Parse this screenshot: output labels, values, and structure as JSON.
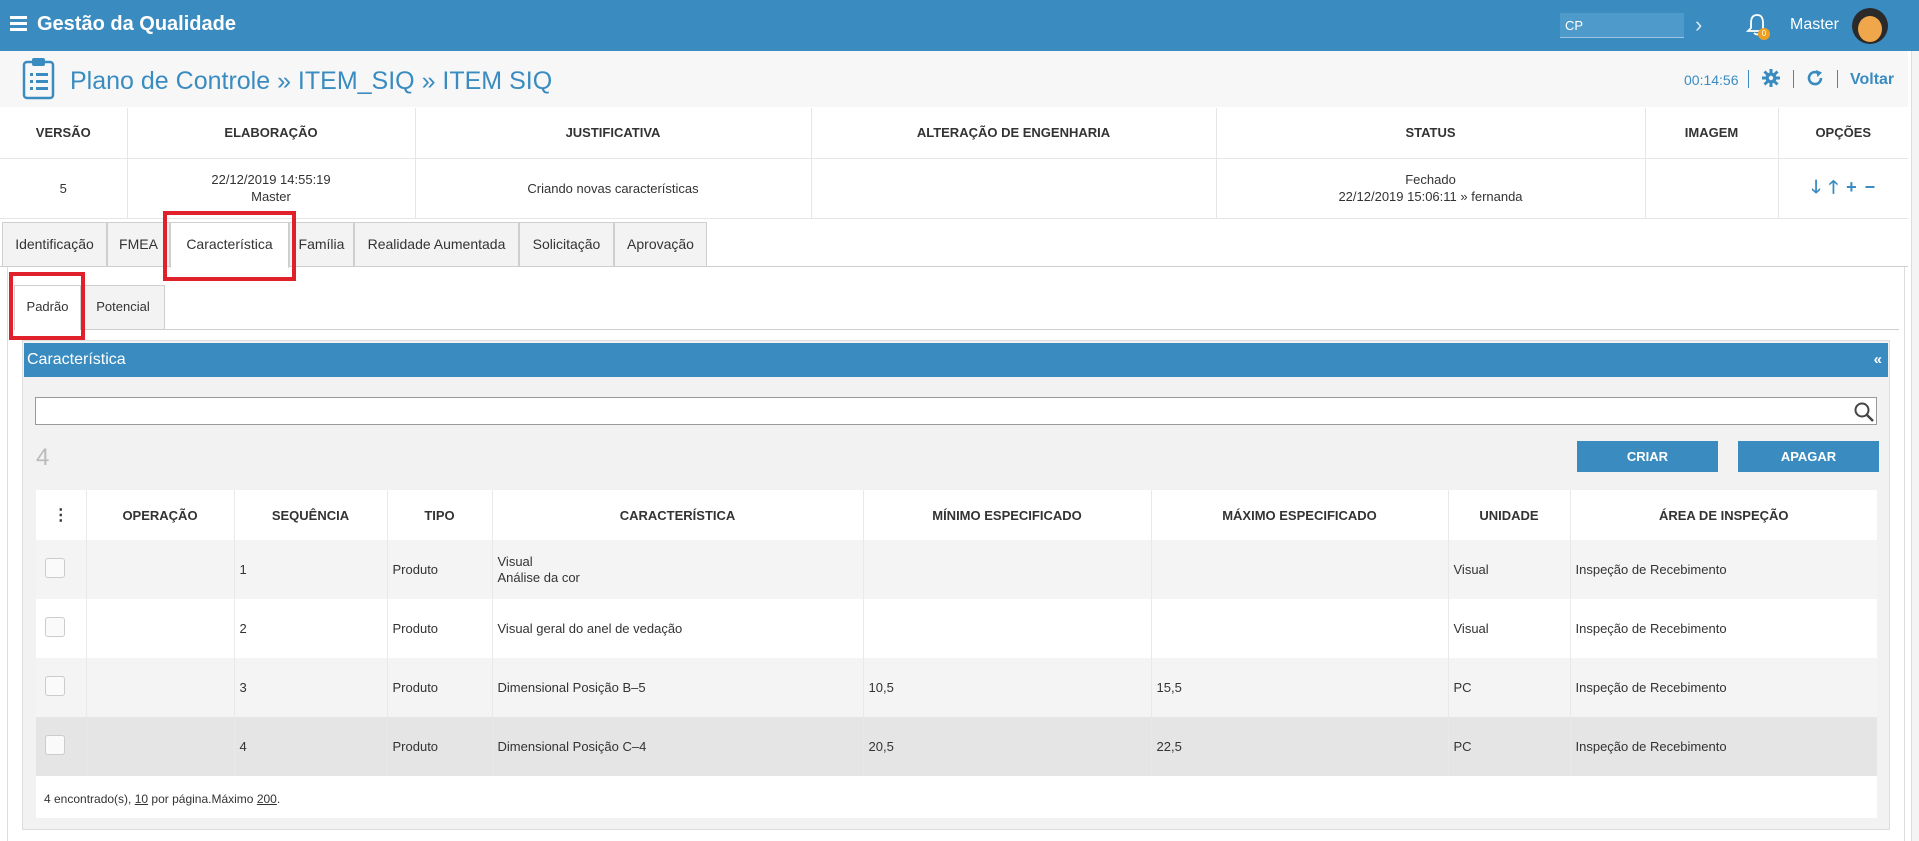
{
  "app": {
    "title": "Gestão da Qualidade",
    "cp_value": "CP",
    "user": "Master",
    "notifications": "0"
  },
  "header": {
    "breadcrumb": "Plano de Controle » ITEM_SIQ » ITEM SIQ",
    "timer": "00:14:56",
    "back_label": "Voltar"
  },
  "version_table": {
    "columns": [
      "VERSÃO",
      "ELABORAÇÃO",
      "JUSTIFICATIVA",
      "ALTERAÇÃO DE ENGENHARIA",
      "STATUS",
      "IMAGEM",
      "OPÇÕES"
    ],
    "row": {
      "version": "5",
      "elab_date": "22/12/2019 14:55:19",
      "elab_user": "Master",
      "justification": "Criando novas características",
      "engineering_change": "",
      "status": "Fechado",
      "status_detail": "22/12/2019 15:06:11 » fernanda",
      "image": ""
    }
  },
  "tabs": [
    "Identificação",
    "FMEA",
    "Característica",
    "Família",
    "Realidade Aumentada",
    "Solicitação",
    "Aprovação"
  ],
  "active_tab": "Característica",
  "sub_tabs": [
    "Padrão",
    "Potencial"
  ],
  "active_sub_tab": "Padrão",
  "section": {
    "title": "Característica",
    "collapse": "«",
    "search_value": "",
    "count": "4",
    "create_label": "CRIAR",
    "delete_label": "APAGAR"
  },
  "table": {
    "columns": [
      "⋮",
      "OPERAÇÃO",
      "SEQUÊNCIA",
      "TIPO",
      "CARACTERÍSTICA",
      "MÍNIMO ESPECIFICADO",
      "MÁXIMO ESPECIFICADO",
      "UNIDADE",
      "ÁREA DE INSPEÇÃO"
    ],
    "rows": [
      {
        "operation": "",
        "sequence": "1",
        "type": "Produto",
        "char_line1": "Visual",
        "char_line2": "Análise da cor",
        "min": "",
        "max": "",
        "unit": "Visual",
        "area": "Inspeção de Recebimento"
      },
      {
        "operation": "",
        "sequence": "2",
        "type": "Produto",
        "char_line1": "Visual geral do anel de vedação",
        "char_line2": "",
        "min": "",
        "max": "",
        "unit": "Visual",
        "area": "Inspeção de Recebimento"
      },
      {
        "operation": "",
        "sequence": "3",
        "type": "Produto",
        "char_line1": "Dimensional Posição B–5",
        "char_line2": "",
        "min": "10,5",
        "max": "15,5",
        "unit": "PC",
        "area": "Inspeção de Recebimento"
      },
      {
        "operation": "",
        "sequence": "4",
        "type": "Produto",
        "char_line1": "Dimensional Posição C–4",
        "char_line2": "",
        "min": "20,5",
        "max": "22,5",
        "unit": "PC",
        "area": "Inspeção de Recebimento"
      }
    ],
    "footer_found": "4 encontrado(s), ",
    "footer_per_page": "10",
    "footer_mid": " por página.Máximo ",
    "footer_max": "200",
    "footer_end": "."
  }
}
